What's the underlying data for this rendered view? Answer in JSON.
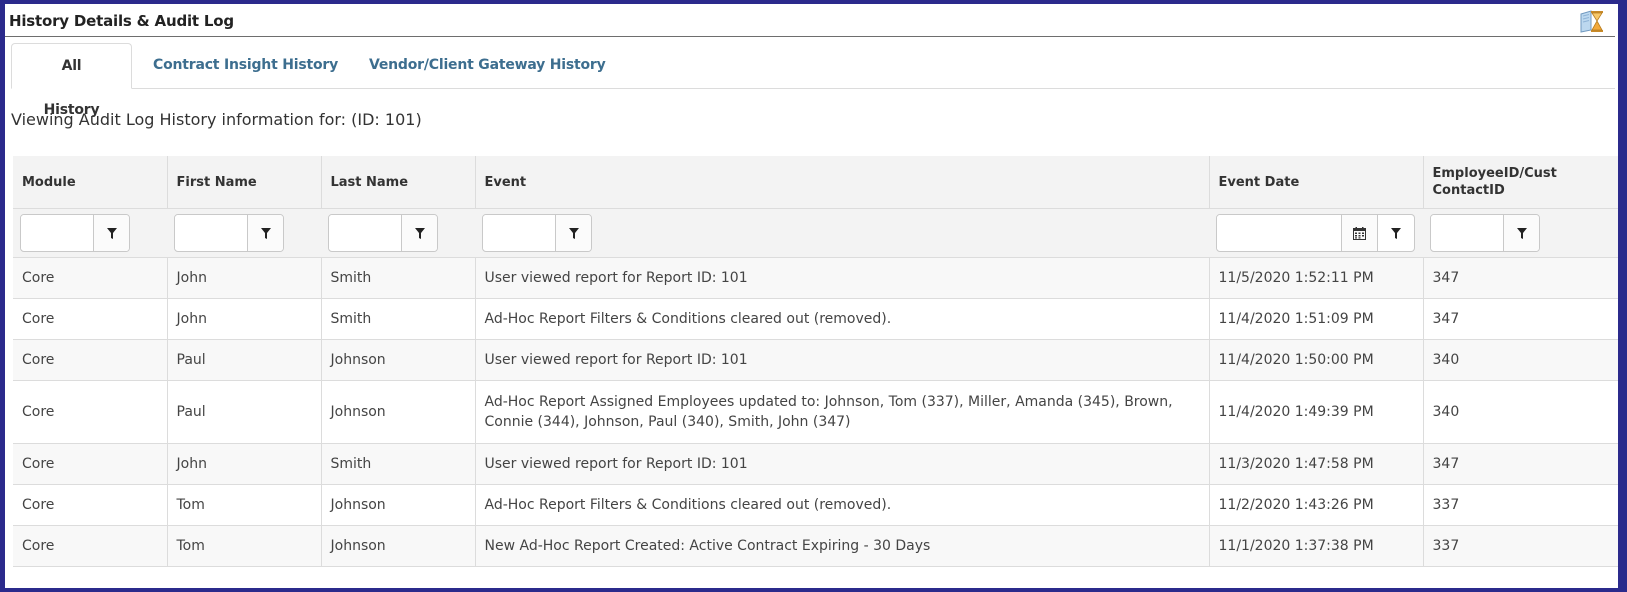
{
  "header": {
    "title": "History Details & Audit Log",
    "icon": "history-hourglass-icon"
  },
  "tabs": [
    {
      "label": "All History",
      "active": true
    },
    {
      "label": "Contract Insight History",
      "active": false
    },
    {
      "label": "Vendor/Client Gateway History",
      "active": false
    }
  ],
  "viewing_text": "Viewing Audit Log History information for: (ID: 101)",
  "table": {
    "columns": [
      "Module",
      "First Name",
      "Last Name",
      "Event",
      "Event Date",
      "EmployeeID/Cust ContactID"
    ],
    "filters": {
      "module": "",
      "first_name": "",
      "last_name": "",
      "event": "",
      "event_date": "",
      "employee_id": ""
    },
    "rows": [
      {
        "module": "Core",
        "first_name": "John",
        "last_name": "Smith",
        "event": "User viewed report for Report ID: 101",
        "event_date": "11/5/2020 1:52:11 PM",
        "employee_id": "347"
      },
      {
        "module": "Core",
        "first_name": "John",
        "last_name": "Smith",
        "event": "Ad-Hoc Report Filters & Conditions cleared out (removed).",
        "event_date": "11/4/2020 1:51:09 PM",
        "employee_id": "347"
      },
      {
        "module": "Core",
        "first_name": "Paul",
        "last_name": "Johnson",
        "event": "User viewed report for Report ID: 101",
        "event_date": "11/4/2020 1:50:00 PM",
        "employee_id": "340"
      },
      {
        "module": "Core",
        "first_name": "Paul",
        "last_name": "Johnson",
        "event": "Ad-Hoc Report Assigned Employees updated to: Johnson, Tom (337), Miller, Amanda (345), Brown, Connie (344), Johnson, Paul (340), Smith, John (347)",
        "event_date": "11/4/2020 1:49:39 PM",
        "employee_id": "340"
      },
      {
        "module": "Core",
        "first_name": "John",
        "last_name": "Smith",
        "event": "User viewed report for Report ID: 101",
        "event_date": "11/3/2020 1:47:58 PM",
        "employee_id": "347"
      },
      {
        "module": "Core",
        "first_name": "Tom",
        "last_name": "Johnson",
        "event": "Ad-Hoc Report Filters & Conditions cleared out (removed).",
        "event_date": "11/2/2020 1:43:26 PM",
        "employee_id": "337"
      },
      {
        "module": "Core",
        "first_name": "Tom",
        "last_name": "Johnson",
        "event": "New Ad-Hoc Report Created: Active Contract Expiring - 30 Days",
        "event_date": "11/1/2020 1:37:38 PM",
        "employee_id": "337"
      }
    ]
  },
  "colors": {
    "frame": "#2b2a8c",
    "tab_link": "#3d6e8f",
    "header_bg": "#f3f3f3",
    "border": "#dcdcdc"
  }
}
